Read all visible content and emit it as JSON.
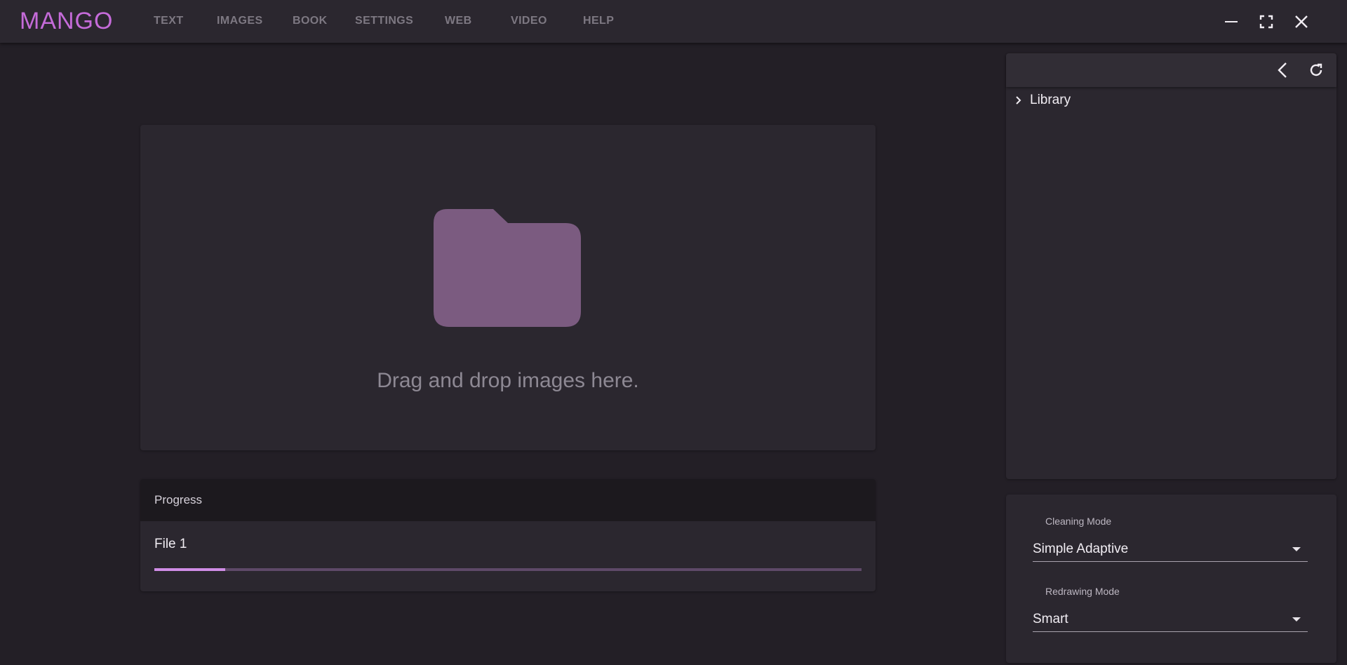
{
  "app": {
    "logo_text": "MANGO"
  },
  "nav": {
    "items": [
      {
        "label": "TEXT"
      },
      {
        "label": "IMAGES"
      },
      {
        "label": "BOOK"
      },
      {
        "label": "SETTINGS"
      },
      {
        "label": "WEB"
      },
      {
        "label": "VIDEO"
      },
      {
        "label": "HELP"
      }
    ]
  },
  "window_controls": {
    "icons": [
      "minimize-icon",
      "fullscreen-icon",
      "close-icon"
    ]
  },
  "dropzone": {
    "icon": "folder-icon",
    "text": "Drag and drop images here."
  },
  "progress": {
    "title": "Progress",
    "files": [
      {
        "name": "File 1",
        "progress_fraction": 0.1
      }
    ]
  },
  "library": {
    "toolbar_icons": [
      "back-icon",
      "refresh-icon"
    ],
    "tree": [
      {
        "label": "Library",
        "expanded": false
      }
    ]
  },
  "settings": {
    "cleaning_mode": {
      "label": "Cleaning Mode",
      "value": "Simple Adaptive"
    },
    "redrawing_mode": {
      "label": "Redrawing Mode",
      "value": "Smart"
    }
  },
  "colors": {
    "accent": "#c56bd9",
    "folder": "#7b5b80",
    "progress_fill": "#d08de6",
    "progress_track": "#5e4968",
    "background": "#231f26",
    "surface": "#2b272f"
  }
}
